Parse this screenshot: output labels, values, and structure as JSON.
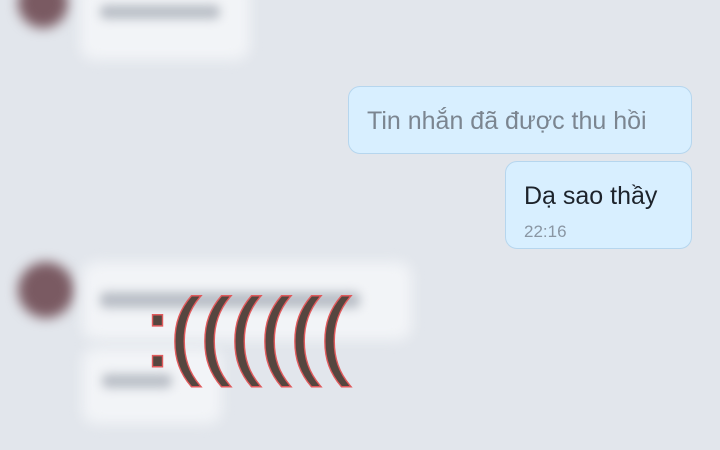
{
  "conversation": {
    "outgoing": [
      {
        "text": "Tin nhắn đã được thu hồi",
        "recalled": true
      },
      {
        "text": "Dạ sao thầy",
        "time": "22:16"
      }
    ]
  },
  "overlay": {
    "text": ":((((((",
    "fill_color": "#55463f",
    "outline_color": "#e05a5c"
  },
  "colors": {
    "background": "#e2e6ec",
    "outgoing_bubble": "#d8efff",
    "outgoing_border": "#b6d6ee"
  }
}
